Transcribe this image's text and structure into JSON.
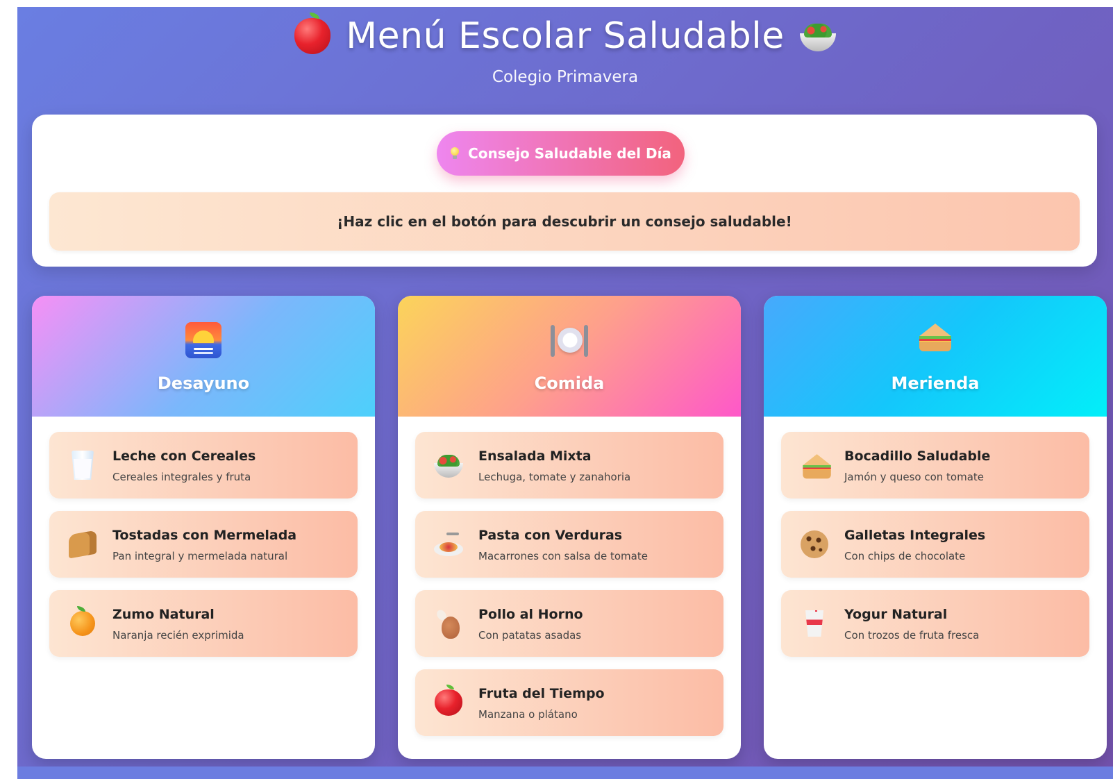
{
  "header": {
    "title": "Menú Escolar Saludable",
    "subtitle": "Colegio Primavera",
    "left_icon": "apple-icon",
    "right_icon": "salad-icon"
  },
  "tip": {
    "button_label": "Consejo Saludable del Día",
    "button_icon": "lightbulb-icon",
    "message": "¡Haz clic en el botón para descubrir un consejo saludable!"
  },
  "meals": [
    {
      "title": "Desayuno",
      "icon": "sunrise-icon",
      "items": [
        {
          "name": "Leche con Cereales",
          "desc": "Cereales integrales y fruta",
          "icon": "glass-of-milk-icon"
        },
        {
          "name": "Tostadas con Mermelada",
          "desc": "Pan integral y mermelada natural",
          "icon": "bread-icon"
        },
        {
          "name": "Zumo Natural",
          "desc": "Naranja recién exprimida",
          "icon": "orange-icon"
        }
      ]
    },
    {
      "title": "Comida",
      "icon": "plate-icon",
      "items": [
        {
          "name": "Ensalada Mixta",
          "desc": "Lechuga, tomate y zanahoria",
          "icon": "salad-icon"
        },
        {
          "name": "Pasta con Verduras",
          "desc": "Macarrones con salsa de tomate",
          "icon": "spaghetti-icon"
        },
        {
          "name": "Pollo al Horno",
          "desc": "Con patatas asadas",
          "icon": "drumstick-icon"
        },
        {
          "name": "Fruta del Tiempo",
          "desc": "Manzana o plátano",
          "icon": "apple-icon"
        }
      ]
    },
    {
      "title": "Merienda",
      "icon": "sandwich-icon",
      "items": [
        {
          "name": "Bocadillo Saludable",
          "desc": "Jamón y queso con tomate",
          "icon": "sandwich-icon"
        },
        {
          "name": "Galletas Integrales",
          "desc": "Con chips de chocolate",
          "icon": "cookie-icon"
        },
        {
          "name": "Yogur Natural",
          "desc": "Con trozos de fruta fresca",
          "icon": "cup-icon"
        }
      ]
    }
  ],
  "colors": {
    "background": "#6f63c4",
    "button_start": "#ee86ef",
    "button_end": "#f2637d",
    "item_start": "#fde5d2",
    "item_end": "#fcbca5"
  }
}
